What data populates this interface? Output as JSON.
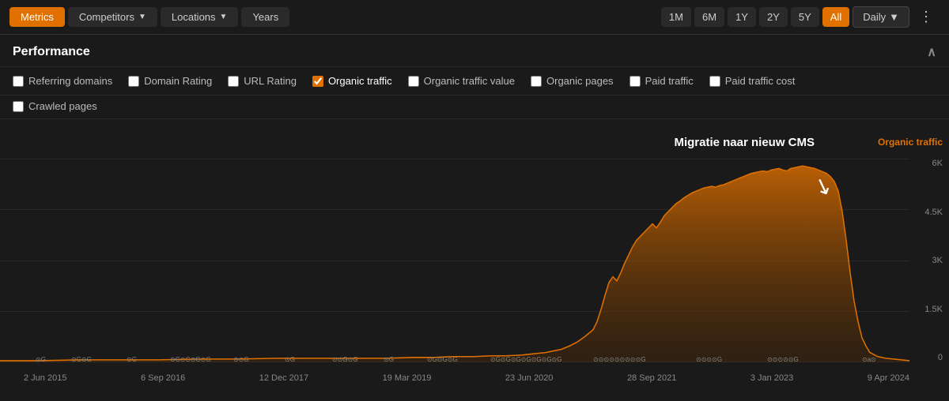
{
  "toolbar": {
    "metrics_label": "Metrics",
    "competitors_label": "Competitors",
    "locations_label": "Locations",
    "years_label": "Years",
    "time_buttons": [
      "1M",
      "6M",
      "1Y",
      "2Y",
      "5Y",
      "All"
    ],
    "active_time": "All",
    "daily_label": "Daily",
    "more_icon": "⋮"
  },
  "performance": {
    "title": "Performance",
    "checkboxes": [
      {
        "id": "referring-domains",
        "label": "Referring domains",
        "checked": false
      },
      {
        "id": "domain-rating",
        "label": "Domain Rating",
        "checked": false
      },
      {
        "id": "url-rating",
        "label": "URL Rating",
        "checked": false
      },
      {
        "id": "organic-traffic",
        "label": "Organic traffic",
        "checked": true
      },
      {
        "id": "organic-traffic-value",
        "label": "Organic traffic value",
        "checked": false
      },
      {
        "id": "organic-pages",
        "label": "Organic pages",
        "checked": false
      },
      {
        "id": "paid-traffic",
        "label": "Paid traffic",
        "checked": false
      },
      {
        "id": "paid-traffic-cost",
        "label": "Paid traffic cost",
        "checked": false
      }
    ],
    "checkboxes_row2": [
      {
        "id": "crawled-pages",
        "label": "Crawled pages",
        "checked": false
      }
    ]
  },
  "chart": {
    "annotation_text": "Migratie naar nieuw CMS",
    "organic_traffic_label": "Organic traffic",
    "y_labels": [
      "6K",
      "4.5K",
      "3K",
      "1.5K",
      "0"
    ],
    "x_labels": [
      "2 Jun 2015",
      "6 Sep 2016",
      "12 Dec 2017",
      "19 Mar 2019",
      "23 Jun 2020",
      "28 Sep 2021",
      "3 Jan 2023",
      "9 Apr 2024"
    ]
  }
}
